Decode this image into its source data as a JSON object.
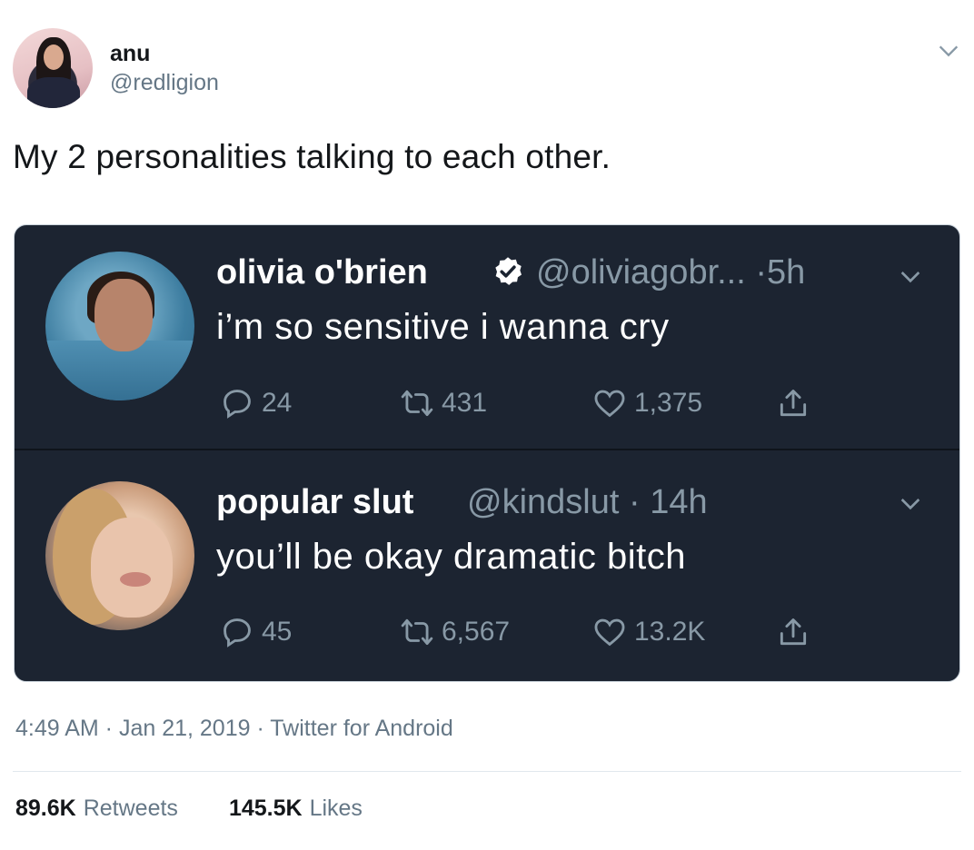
{
  "author": {
    "display_name": "anu",
    "handle": "@redligion"
  },
  "tweet_text": "My 2 personalities talking to each other.",
  "card": {
    "replies": [
      {
        "name": "olivia o'brien",
        "verified": true,
        "handle": "@oliviagobr... ·5h",
        "text": "i’m so sensitive i wanna cry",
        "replies_count": "24",
        "retweets_count": "431",
        "likes_count": "1,375"
      },
      {
        "name": "popular slut",
        "verified": false,
        "handle": "@kindslut · 14h",
        "text": "you’ll be okay dramatic bitch",
        "replies_count": "45",
        "retweets_count": "6,567",
        "likes_count": "13.2K"
      }
    ]
  },
  "meta": "4:49 AM · Jan 21, 2019 · Twitter for Android",
  "stats": {
    "retweets_value": "89.6K",
    "retweets_label": "Retweets",
    "likes_value": "145.5K",
    "likes_label": "Likes"
  },
  "colors": {
    "card_bg": "#1c2431",
    "muted": "#657786",
    "dark_muted": "#8899a6",
    "verified_bg": "#ffffff"
  }
}
